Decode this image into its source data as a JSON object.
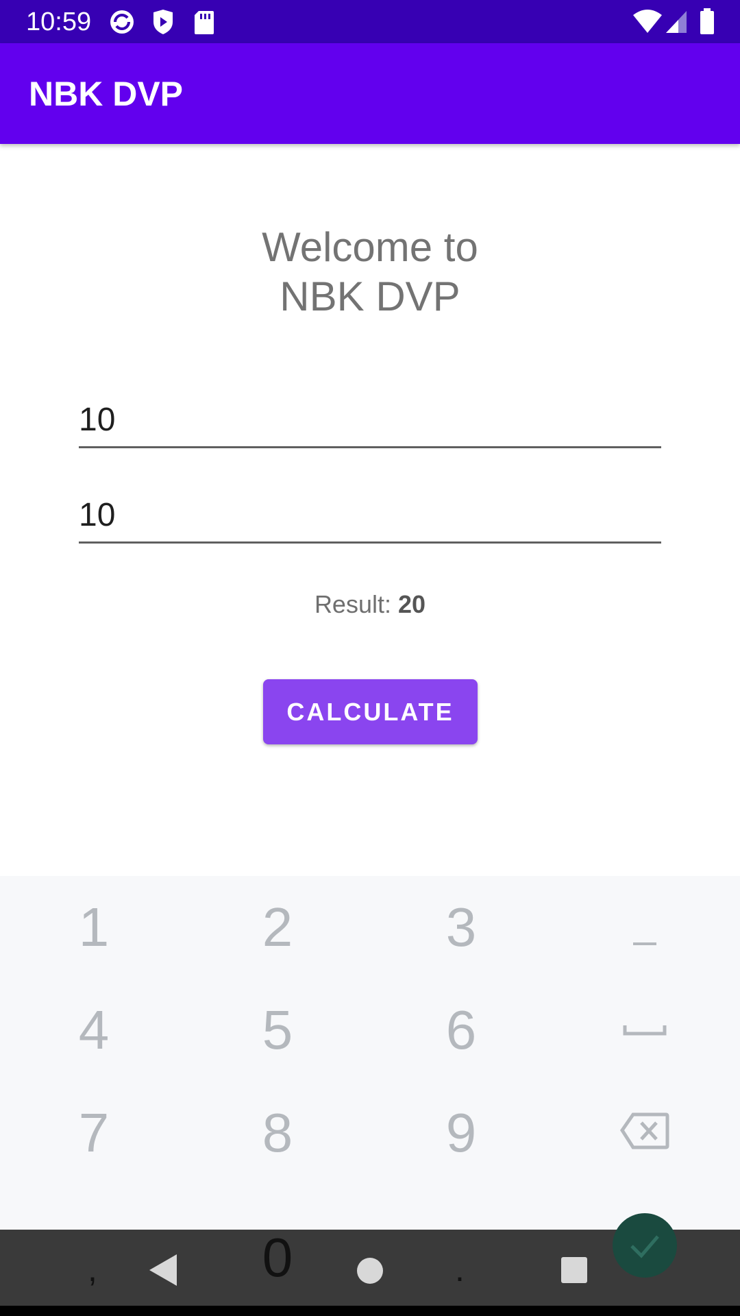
{
  "status_bar": {
    "time": "10:59",
    "left_icons": [
      "sync-icon",
      "shield-icon",
      "sd-card-icon"
    ],
    "right_icons": [
      "wifi-icon",
      "signal-icon",
      "battery-icon"
    ],
    "color": "#3700B3"
  },
  "app_bar": {
    "title": "NBK DVP",
    "color": "#6200EE"
  },
  "main": {
    "welcome_line1": "Welcome to",
    "welcome_line2": "NBK DVP",
    "input1_value": "10",
    "input2_value": "10",
    "result_label": "Result:",
    "result_value": "20",
    "calculate_label": "CALCULATE",
    "button_color": "#8A45EF"
  },
  "keyboard": {
    "keys": [
      "1",
      "2",
      "3",
      "–",
      "4",
      "5",
      "6",
      "space",
      "7",
      "8",
      "9",
      "backspace"
    ],
    "bottom_row": [
      ",",
      "0",
      ".",
      "done"
    ],
    "symbol_icons": [
      "minus-icon",
      "space-icon",
      "backspace-icon",
      "check-icon"
    ]
  },
  "nav_bar": {
    "buttons": [
      "back-icon",
      "home-icon",
      "recents-icon"
    ]
  }
}
